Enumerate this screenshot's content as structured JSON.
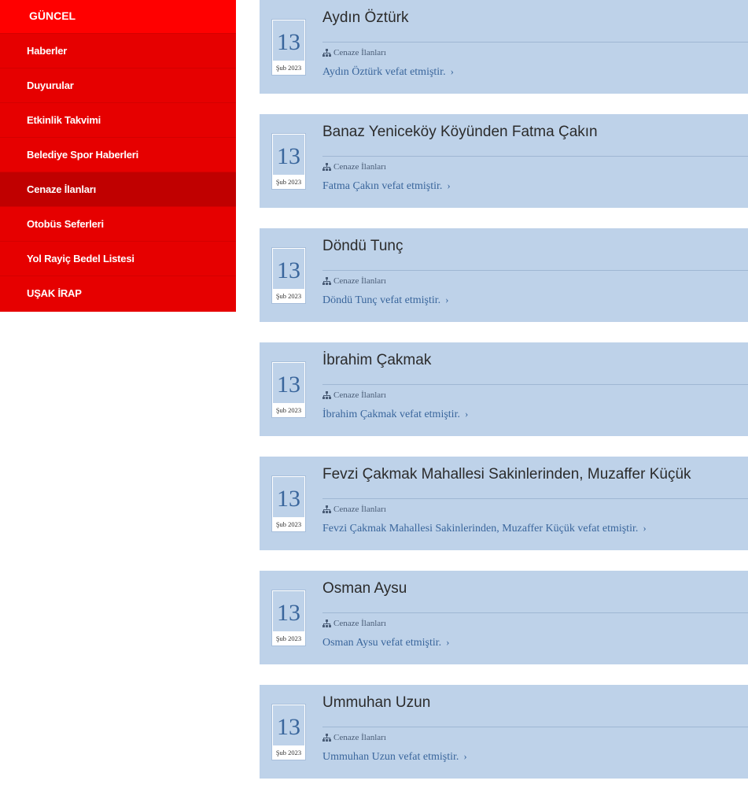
{
  "sidebar": {
    "header": "GÜNCEL",
    "items": [
      {
        "label": "Haberler",
        "active": false
      },
      {
        "label": "Duyurular",
        "active": false
      },
      {
        "label": "Etkinlik Takvimi",
        "active": false
      },
      {
        "label": "Belediye Spor Haberleri",
        "active": false
      },
      {
        "label": "Cenaze İlanları",
        "active": true
      },
      {
        "label": "Otobüs Seferleri",
        "active": false
      },
      {
        "label": "Yol Rayiç Bedel Listesi",
        "active": false
      },
      {
        "label": "UŞAK İRAP",
        "active": false
      }
    ]
  },
  "posts": [
    {
      "day": "13",
      "month": "Şub 2023",
      "title": "Aydın Öztürk",
      "category": "Cenaze İlanları",
      "summary": "Aydın Öztürk vefat etmiştir.",
      "chevron": "›"
    },
    {
      "day": "13",
      "month": "Şub 2023",
      "title": "Banaz Yeniceköy Köyünden Fatma Çakın",
      "category": "Cenaze İlanları",
      "summary": "Fatma Çakın vefat etmiştir.",
      "chevron": "›"
    },
    {
      "day": "13",
      "month": "Şub 2023",
      "title": "Döndü Tunç",
      "category": "Cenaze İlanları",
      "summary": "Döndü Tunç vefat etmiştir.",
      "chevron": "›"
    },
    {
      "day": "13",
      "month": "Şub 2023",
      "title": "İbrahim Çakmak",
      "category": "Cenaze İlanları",
      "summary": "İbrahim Çakmak vefat etmiştir.",
      "chevron": "›"
    },
    {
      "day": "13",
      "month": "Şub 2023",
      "title": "Fevzi Çakmak Mahallesi Sakinlerinden, Muzaffer Küçük",
      "category": "Cenaze İlanları",
      "summary": "Fevzi Çakmak Mahallesi Sakinlerinden, Muzaffer Küçük vefat etmiştir.",
      "chevron": "›"
    },
    {
      "day": "13",
      "month": "Şub 2023",
      "title": "Osman Aysu",
      "category": "Cenaze İlanları",
      "summary": "Osman Aysu vefat etmiştir.",
      "chevron": "›"
    },
    {
      "day": "13",
      "month": "Şub 2023",
      "title": "Ummuhan Uzun",
      "category": "Cenaze İlanları",
      "summary": "Ummuhan Uzun vefat etmiştir.",
      "chevron": "›"
    }
  ],
  "colors": {
    "sidebar_bg": "#e60000",
    "sidebar_header_bg": "#ff0000",
    "sidebar_active_bg": "#c00000",
    "card_bg": "#bed2e9",
    "accent_blue": "#3a669c"
  },
  "icons": {
    "category": "sitemap-icon",
    "link_arrow": "chevron-right-icon"
  }
}
